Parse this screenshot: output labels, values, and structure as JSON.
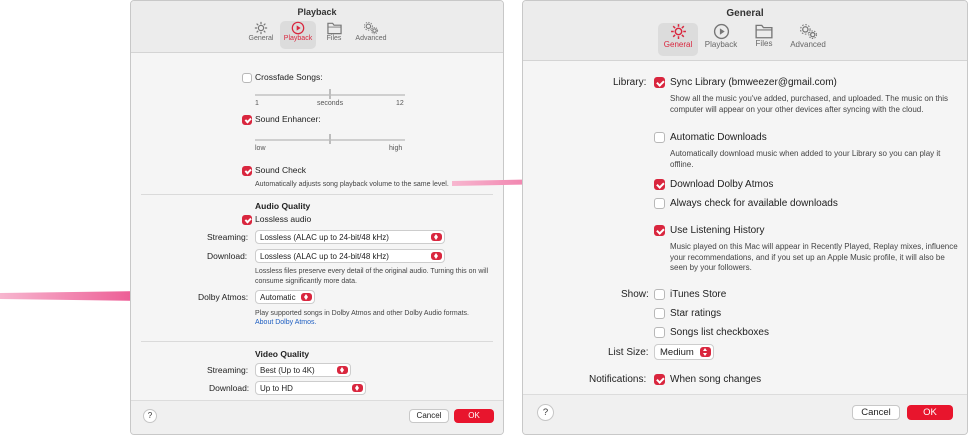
{
  "playback_window": {
    "title": "Playback",
    "toolbar": [
      {
        "label": "General",
        "icon": "gear-icon"
      },
      {
        "label": "Playback",
        "icon": "play-circle-icon"
      },
      {
        "label": "Files",
        "icon": "folder-icon"
      },
      {
        "label": "Advanced",
        "icon": "advanced-gears-icon"
      }
    ],
    "crossfade_label": "Crossfade Songs:",
    "crossfade_checked": false,
    "crossfade_min": "1",
    "crossfade_mid": "seconds",
    "crossfade_max": "12",
    "enhancer_label": "Sound Enhancer:",
    "enhancer_checked": true,
    "enhancer_min": "low",
    "enhancer_max": "high",
    "sound_check_label": "Sound Check",
    "sound_check_checked": true,
    "sound_check_desc": "Automatically adjusts song playback volume to the same level.",
    "audio_quality_heading": "Audio Quality",
    "lossless_label": "Lossless audio",
    "lossless_checked": true,
    "streaming_label": "Streaming:",
    "streaming_value": "Lossless (ALAC up to 24-bit/48 kHz)",
    "download_label": "Download:",
    "download_value": "Lossless (ALAC up to 24-bit/48 kHz)",
    "lossless_desc": "Lossless files preserve every detail of the original audio. Turning this on will consume significantly more data.",
    "dolby_label": "Dolby Atmos:",
    "dolby_value": "Automatic",
    "dolby_desc": "Play supported songs in Dolby Atmos and other Dolby Audio formats.",
    "dolby_link": "About Dolby Atmos.",
    "video_quality_heading": "Video Quality",
    "video_streaming_label": "Streaming:",
    "video_streaming_value": "Best (Up to 4K)",
    "video_download_label": "Download:",
    "video_download_value": "Up to HD",
    "help_label": "?",
    "cancel_label": "Cancel",
    "ok_label": "OK"
  },
  "general_window": {
    "title": "General",
    "toolbar": [
      {
        "label": "General",
        "icon": "gear-icon"
      },
      {
        "label": "Playback",
        "icon": "play-circle-icon"
      },
      {
        "label": "Files",
        "icon": "folder-icon"
      },
      {
        "label": "Advanced",
        "icon": "advanced-gears-icon"
      }
    ],
    "library_label": "Library:",
    "sync_label": "Sync Library (bmweezer@gmail.com)",
    "sync_checked": true,
    "sync_desc": "Show all the music you've added, purchased, and uploaded. The music on this computer will appear on your other devices after syncing with the cloud.",
    "auto_downloads_label": "Automatic Downloads",
    "auto_downloads_checked": false,
    "auto_downloads_desc": "Automatically download music when added to your Library so you can play it offline.",
    "dolby_download_label": "Download Dolby Atmos",
    "dolby_download_checked": true,
    "check_downloads_label": "Always check for available downloads",
    "check_downloads_checked": false,
    "listening_history_label": "Use Listening History",
    "listening_history_checked": true,
    "listening_history_desc": "Music played on this Mac will appear in Recently Played, Replay mixes, influence your recommendations, and if you set up an Apple Music profile, it will also be seen by your followers.",
    "show_label": "Show:",
    "itunes_store_label": "iTunes Store",
    "itunes_store_checked": false,
    "star_ratings_label": "Star ratings",
    "star_ratings_checked": false,
    "songs_checkboxes_label": "Songs list checkboxes",
    "songs_checkboxes_checked": false,
    "list_size_label": "List Size:",
    "list_size_value": "Medium",
    "notifications_label": "Notifications:",
    "notifications_value_label": "When song changes",
    "notifications_checked": true,
    "help_label": "?",
    "cancel_label": "Cancel",
    "ok_label": "OK"
  },
  "colors": {
    "accent": "#d9263e",
    "arrow": "#e8337a",
    "link": "#1f5fc2"
  }
}
